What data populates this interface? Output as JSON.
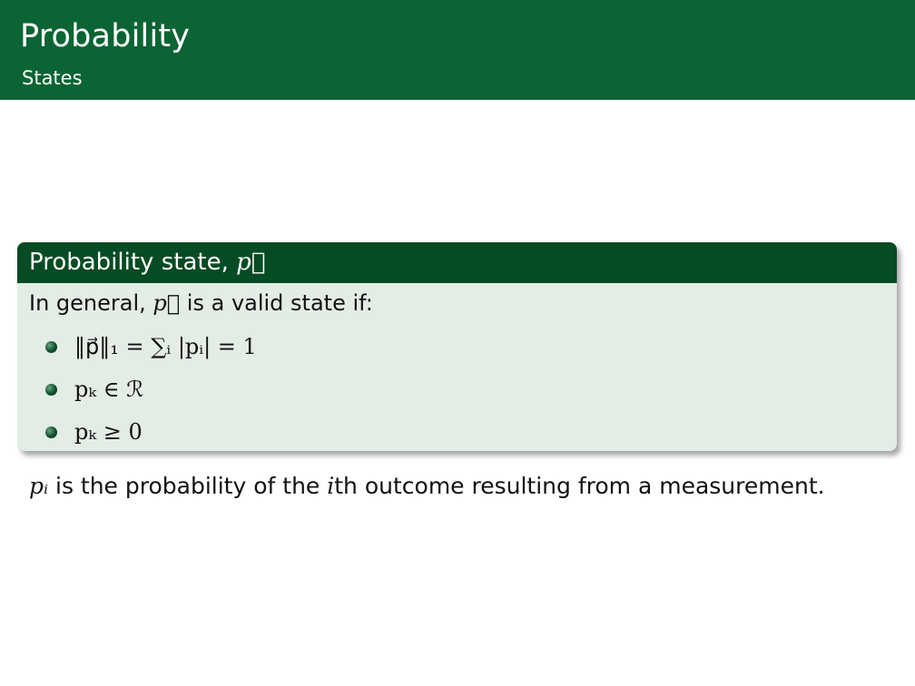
{
  "header": {
    "title": "Probability",
    "subtitle": "States"
  },
  "block": {
    "title_text": "Probability state, ",
    "title_symbol": "p⃗",
    "intro_prefix": "In general, ",
    "intro_symbol": "p⃗",
    "intro_suffix": " is a valid state if:",
    "bullets": [
      "‖p⃗‖₁ = ∑ᵢ |pᵢ| = 1",
      "pₖ ∈ ℛ",
      "pₖ ≥ 0"
    ]
  },
  "footnote": {
    "symbol": "pᵢ",
    "text_a": " is the probability of the ",
    "symbol_i": "i",
    "text_b": "th outcome resulting from a measurement."
  }
}
